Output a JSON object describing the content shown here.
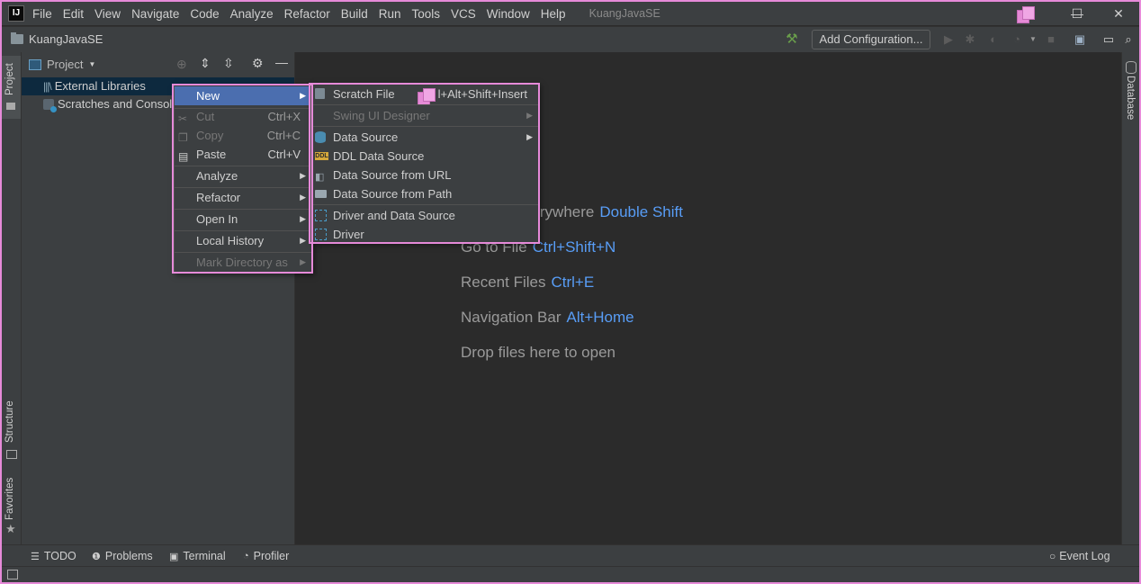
{
  "menubar": {
    "items": [
      "File",
      "Edit",
      "View",
      "Navigate",
      "Code",
      "Analyze",
      "Refactor",
      "Build",
      "Run",
      "Tools",
      "VCS",
      "Window",
      "Help"
    ],
    "window_title": "KuangJavaSE",
    "minimize": "—",
    "maximize": "☐",
    "close": "✕"
  },
  "navbar": {
    "project_name": "KuangJavaSE",
    "add_configuration": "Add Configuration..."
  },
  "left_tabs": {
    "project": "Project",
    "structure": "Structure",
    "favorites": "Favorites"
  },
  "right_tabs": {
    "database": "Database"
  },
  "project_panel": {
    "title": "Project",
    "rows": [
      "External Libraries",
      "Scratches and Consoles"
    ]
  },
  "editor_hints": [
    {
      "text": "Search Everywhere",
      "key": "Double Shift"
    },
    {
      "text": "Go to File",
      "key": "Ctrl+Shift+N"
    },
    {
      "text": "Recent Files",
      "key": "Ctrl+E"
    },
    {
      "text": "Navigation Bar",
      "key": "Alt+Home"
    },
    {
      "text": "Drop files here to open",
      "key": ""
    }
  ],
  "context_menu": {
    "items": [
      {
        "label": "New",
        "shortcut": ""
      },
      {
        "label": "Cut",
        "shortcut": "Ctrl+X"
      },
      {
        "label": "Copy",
        "shortcut": "Ctrl+C"
      },
      {
        "label": "Paste",
        "shortcut": "Ctrl+V"
      },
      {
        "label": "Analyze",
        "shortcut": ""
      },
      {
        "label": "Refactor",
        "shortcut": ""
      },
      {
        "label": "Open In",
        "shortcut": ""
      },
      {
        "label": "Local History",
        "shortcut": ""
      },
      {
        "label": "Mark Directory as",
        "shortcut": ""
      }
    ]
  },
  "new_submenu": {
    "items": [
      {
        "label": "Scratch File",
        "shortcut": "l+Alt+Shift+Insert"
      },
      {
        "label": "Swing UI Designer",
        "shortcut": ""
      },
      {
        "label": "Data Source",
        "shortcut": ""
      },
      {
        "label": "DDL Data Source",
        "shortcut": ""
      },
      {
        "label": "Data Source from URL",
        "shortcut": ""
      },
      {
        "label": "Data Source from Path",
        "shortcut": ""
      },
      {
        "label": "Driver and Data Source",
        "shortcut": ""
      },
      {
        "label": "Driver",
        "shortcut": ""
      }
    ],
    "ddl_icon_text": "DDL"
  },
  "bottom_tabs": [
    "TODO",
    "Problems",
    "Terminal",
    "Profiler"
  ],
  "event_log": "Event Log",
  "colors": {
    "accent": "#4b6eaf",
    "hint_key": "#589df6",
    "highlight_border": "#e68ad9",
    "build_green": "#6a9f4b"
  }
}
